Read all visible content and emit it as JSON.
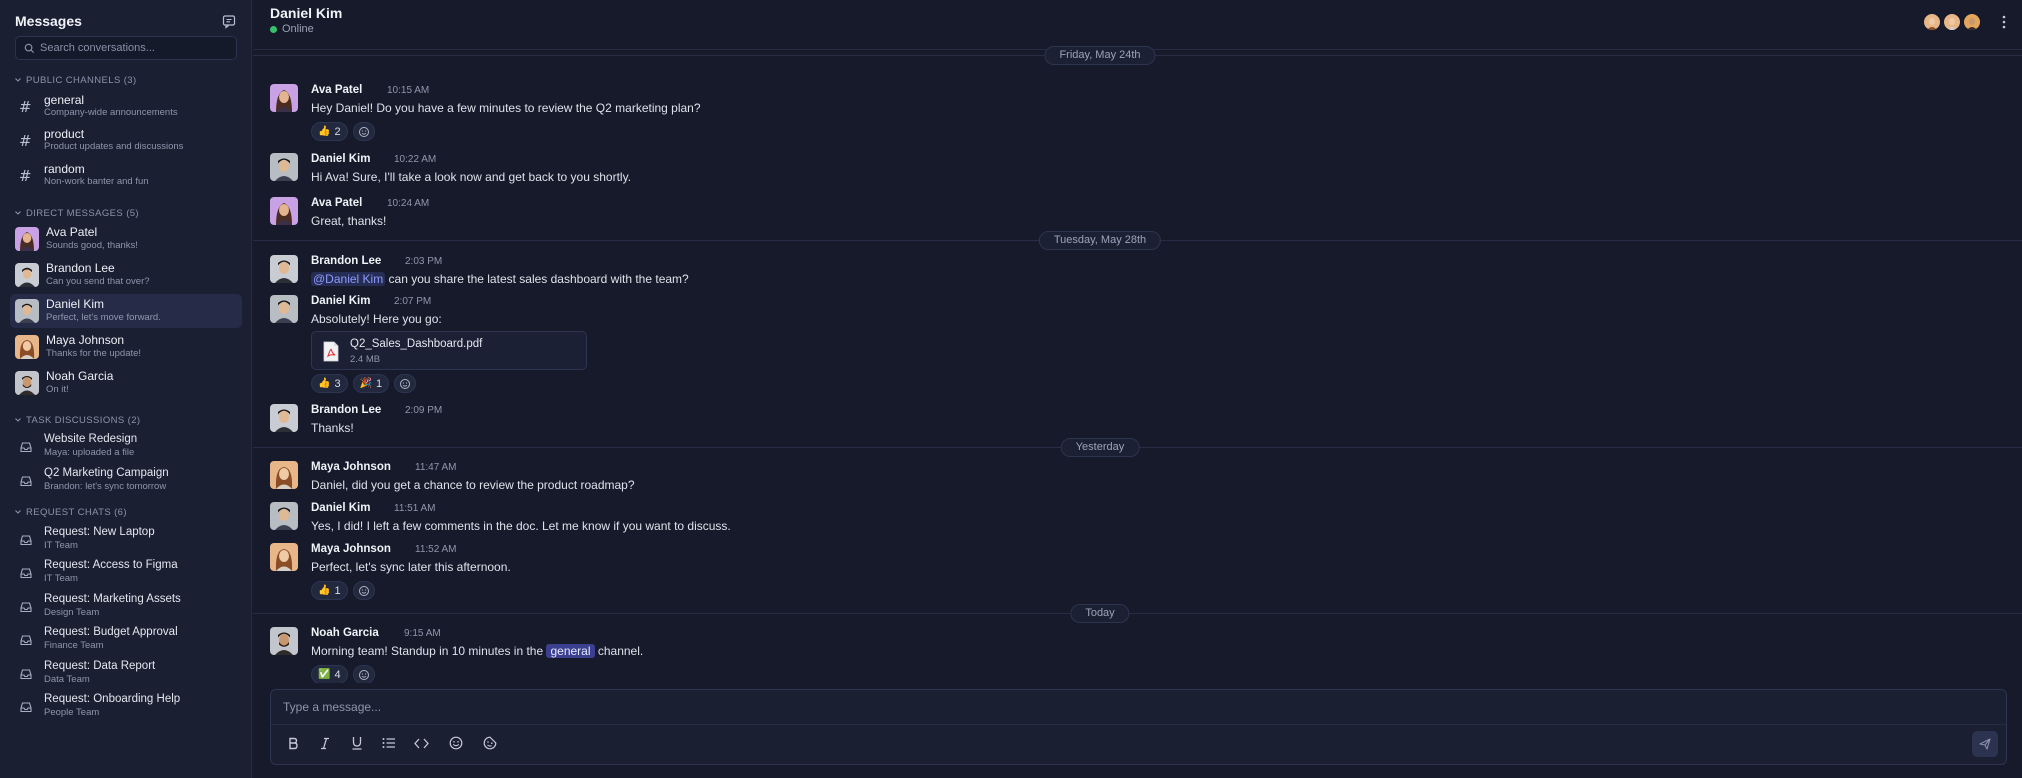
{
  "sidebar": {
    "title": "Messages",
    "search_placeholder": "Search conversations...",
    "public_channels_title": "PUBLIC CHANNELS (3)",
    "channels": [
      {
        "name": "general",
        "desc": "Company-wide announcements"
      },
      {
        "name": "product",
        "desc": "Product updates and discussions"
      },
      {
        "name": "random",
        "desc": "Non-work banter and fun"
      }
    ],
    "direct_messages_title": "DIRECT MESSAGES (5)",
    "dms": [
      {
        "name": "Ava Patel",
        "desc": "Sounds good, thanks!"
      },
      {
        "name": "Brandon Lee",
        "desc": "Can you send that over?"
      },
      {
        "name": "Daniel Kim",
        "desc": "Perfect, let's move forward."
      },
      {
        "name": "Maya Johnson",
        "desc": "Thanks for the update!"
      },
      {
        "name": "Noah Garcia",
        "desc": "On it!"
      }
    ],
    "task_discussions_title": "TASK DISCUSSIONS (2)",
    "tasks": [
      {
        "name": "Website Redesign",
        "desc": "Maya: uploaded a file"
      },
      {
        "name": "Q2 Marketing Campaign",
        "desc": "Brandon: let's sync tomorrow"
      }
    ],
    "request_chats_title": "REQUEST CHATS (6)",
    "requests": [
      {
        "name": "Request: New Laptop",
        "desc": "IT Team"
      },
      {
        "name": "Request: Access to Figma",
        "desc": "IT Team"
      },
      {
        "name": "Request: Marketing Assets",
        "desc": "Design Team"
      },
      {
        "name": "Request: Budget Approval",
        "desc": "Finance Team"
      },
      {
        "name": "Request: Data Report",
        "desc": "Data Team"
      },
      {
        "name": "Request: Onboarding Help",
        "desc": "People Team"
      }
    ]
  },
  "header": {
    "name": "Daniel Kim",
    "status": "Online"
  },
  "dates": [
    "Friday, May 24th",
    "Tuesday, May 28th",
    "Yesterday",
    "Today"
  ],
  "messages": [
    {
      "author": "Ava Patel",
      "time": "10:15 AM",
      "text": "Hey Daniel! Do you have a few minutes to review the Q2 marketing plan?",
      "reactions": [
        {
          "emoji": "👍",
          "count": "2"
        }
      ]
    },
    {
      "author": "Daniel Kim",
      "time": "10:22 AM",
      "text": "Hi Ava! Sure, I'll take a look now and get back to you shortly."
    },
    {
      "author": "Ava Patel",
      "time": "10:24 AM",
      "text": "Great, thanks!"
    },
    {
      "author": "Brandon Lee",
      "time": "2:03 PM",
      "mention": "@Daniel Kim",
      "text": " can you share the latest sales dashboard with the team?"
    },
    {
      "author": "Daniel Kim",
      "time": "2:07 PM",
      "text": "Absolutely! Here you go:",
      "file": {
        "name": "Q2_Sales_Dashboard.pdf",
        "size": "2.4 MB"
      },
      "reactions": [
        {
          "emoji": "👍",
          "count": "3"
        },
        {
          "emoji": "🎉",
          "count": "1"
        }
      ]
    },
    {
      "author": "Brandon Lee",
      "time": "2:09 PM",
      "text": "Thanks!"
    },
    {
      "author": "Maya Johnson",
      "time": "11:47 AM",
      "text": "Daniel, did you get a chance to review the product roadmap?"
    },
    {
      "author": "Daniel Kim",
      "time": "11:51 AM",
      "text": "Yes, I did! I left a few comments in the doc. Let me know if you want to discuss."
    },
    {
      "author": "Maya Johnson",
      "time": "11:52 AM",
      "text": "Perfect, let's sync later this afternoon.",
      "reactions": [
        {
          "emoji": "👍",
          "count": "1"
        }
      ]
    },
    {
      "author": "Noah Garcia",
      "time": "9:15 AM",
      "text_before": "Morning team! Standup in 10 minutes in the ",
      "channel": "general",
      "text_after": " channel.",
      "reactions": [
        {
          "emoji": "✅",
          "count": "4"
        }
      ]
    }
  ],
  "composer": {
    "placeholder": "Type a message..."
  },
  "colors": {
    "background": "#161a2b",
    "sidebar": "#1a1f32",
    "accent": "#3b3f8f",
    "online": "#36c26b",
    "mention": "#8e9bff"
  }
}
